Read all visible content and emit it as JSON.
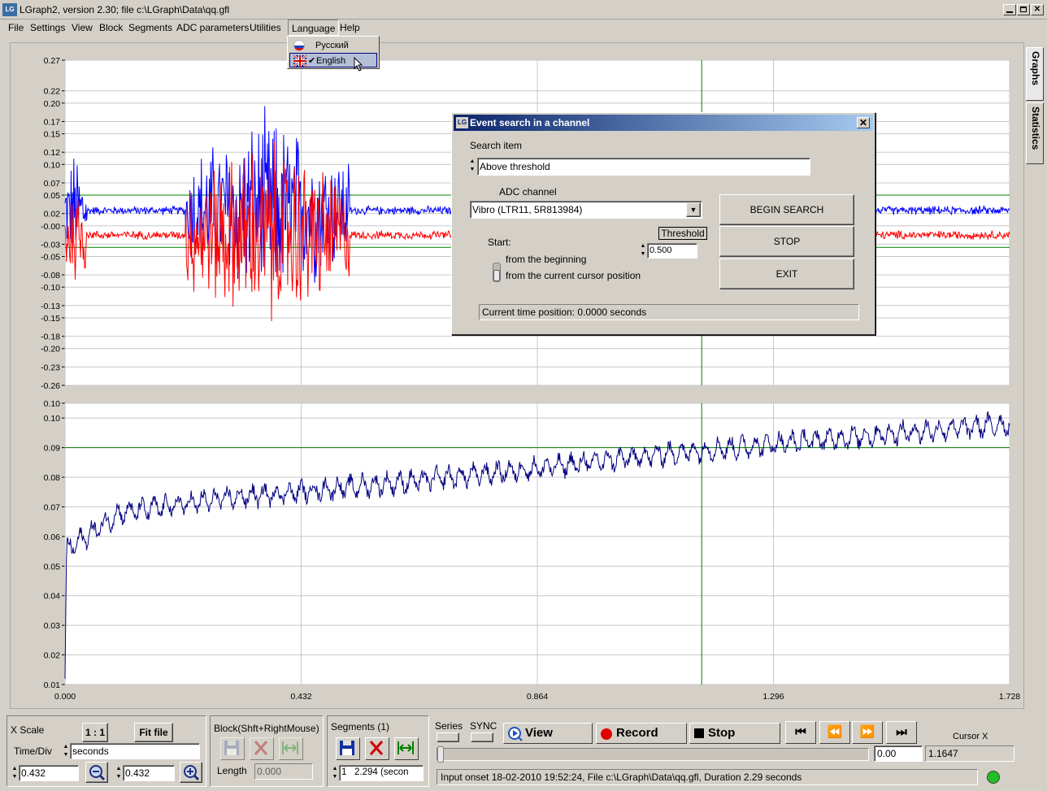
{
  "window": {
    "title": "LGraph2, version  2.30; file c:\\LGraph\\Data\\qq.gfl",
    "app_icon": "LG",
    "minimize_icon": "0",
    "maximize_icon": "1",
    "close_icon": "r"
  },
  "menu": {
    "items": [
      "File",
      "Settings",
      "View",
      "Block",
      "Segments",
      "ADC parameters",
      "Utilities",
      "Language",
      "Help"
    ],
    "active": "Language"
  },
  "language_menu": {
    "items": [
      {
        "label": "Русский",
        "flag": "russia-flag",
        "checked": false
      },
      {
        "label": "English",
        "flag": "uk-flag",
        "checked": true
      }
    ],
    "check_mark": "✔"
  },
  "side_tabs": [
    "Graphs",
    "Statistics"
  ],
  "dialog": {
    "title": "Event search in a channel",
    "icon": "LG",
    "close": "✕",
    "search_item_label": "Search item",
    "search_item_value": "Above threshold",
    "adc_channel_label": "ADC channel",
    "adc_channel_value": "Vibro (LTR11, 5R813984)",
    "dropdown_arrow": "▼",
    "threshold_label": "Threshold",
    "threshold_value": "0.500",
    "start_label": "Start:",
    "start_options": [
      "from the beginning",
      "from the current cursor position"
    ],
    "begin_button": "BEGIN SEARCH",
    "stop_button": "STOP",
    "exit_button": "EXIT",
    "status": "Current time position: 0.0000 seconds",
    "spin_up": "▲",
    "spin_down": "▼"
  },
  "chart_data": [
    {
      "type": "line",
      "title": "",
      "ylim": [
        -0.26,
        0.27
      ],
      "y_ticks": [
        "0.27",
        "0.22",
        "0.20",
        "0.17",
        "0.15",
        "0.12",
        "0.10",
        "0.07",
        "0.05",
        "0.02",
        "-0.00",
        "-0.03",
        "-0.05",
        "-0.08",
        "-0.10",
        "-0.13",
        "-0.15",
        "-0.18",
        "-0.20",
        "-0.23",
        "-0.26"
      ],
      "y_tick_values": [
        0.27,
        0.22,
        0.2,
        0.17,
        0.15,
        0.12,
        0.1,
        0.07,
        0.05,
        0.02,
        0.0,
        -0.03,
        -0.05,
        -0.08,
        -0.1,
        -0.13,
        -0.15,
        -0.18,
        -0.2,
        -0.23,
        -0.26
      ],
      "xlim": [
        0.0,
        1.728
      ],
      "threshold_lines": [
        0.05,
        -0.035
      ],
      "cursor_x": 1.1647,
      "series": [
        {
          "color": "#0000ff",
          "baseline": 0.025,
          "description": "blue signal"
        },
        {
          "color": "#ff0000",
          "baseline": -0.015,
          "description": "red signal"
        }
      ],
      "bursts": [
        [
          0.0,
          0.04,
          0.12
        ],
        [
          0.22,
          0.52,
          0.18
        ],
        [
          0.83,
          0.89,
          0.13
        ],
        [
          1.0,
          1.05,
          0.08
        ]
      ],
      "grid": true
    },
    {
      "type": "line",
      "title": "",
      "ylim": [
        0.01,
        0.105
      ],
      "y_ticks": [
        "0.10",
        "0.10",
        "0.09",
        "0.08",
        "0.07",
        "0.06",
        "0.05",
        "0.04",
        "0.03",
        "0.02",
        "0.01"
      ],
      "y_tick_values": [
        0.105,
        0.1,
        0.09,
        0.08,
        0.07,
        0.06,
        0.05,
        0.04,
        0.03,
        0.02,
        0.01
      ],
      "x_ticks": [
        "0.000",
        "0.432",
        "0.864",
        "1.296",
        "1.728"
      ],
      "x_tick_values": [
        0.0,
        0.432,
        0.864,
        1.296,
        1.728
      ],
      "xlim": [
        0.0,
        1.728
      ],
      "threshold_lines": [
        0.09
      ],
      "cursor_x": 1.1647,
      "series": [
        {
          "color": "#000080",
          "trend": [
            [
              0.0,
              0.055
            ],
            [
              0.1,
              0.068
            ],
            [
              0.3,
              0.073
            ],
            [
              0.6,
              0.078
            ],
            [
              0.864,
              0.083
            ],
            [
              1.1,
              0.088
            ],
            [
              1.4,
              0.093
            ],
            [
              1.728,
              0.098
            ]
          ],
          "amplitude": 0.004
        }
      ],
      "grid": true
    }
  ],
  "bottom": {
    "xscale_label": "X Scale",
    "one_to_one": "1 : 1",
    "fit_file": "Fit file",
    "time_div_label": "Time/Div",
    "time_div_unit": "seconds",
    "time_div_value": "0.432",
    "time_div_value2": "0.432",
    "block_label": "Block(Shft+RightMouse)",
    "length_label": "Length",
    "length_value": "0.000",
    "segments_label": "Segments (1)",
    "segment_index": "1",
    "segment_value": "2.294 (secon",
    "series_label": "Series",
    "sync_label": "SYNC",
    "view_button": "View",
    "record_button": "Record",
    "stop_button": "Stop",
    "nav": [
      "⏮",
      "⏪",
      "⏩",
      "⏭"
    ],
    "position_value": "0.00",
    "cursor_label": "Cursor X",
    "cursor_value": "1.1647",
    "status": "Input onset   18-02-2010 19:52:24, File c:\\LGraph\\Data\\qq.gfl, Duration 2.29 seconds",
    "led_color": "#22c022"
  }
}
